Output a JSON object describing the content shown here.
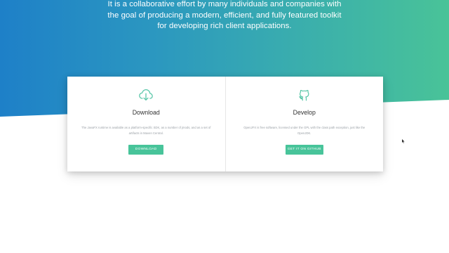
{
  "hero": {
    "line1": "It is a collaborative effort by many individuals and companies with",
    "line2": "the goal of producing a modern, efficient, and fully featured toolkit",
    "line3": "for developing rich client applications."
  },
  "cards": [
    {
      "id": "download",
      "icon": "cloud-download-icon",
      "title": "Download",
      "description": "The JavaFX runtime is available as a platform-specific SDK, as a number of jmods, and as a set of artifacts in Maven Central.",
      "button_label": "DOWNLOAD"
    },
    {
      "id": "develop",
      "icon": "github-icon",
      "title": "Develop",
      "description": "OpenJFX is free software, licensed under the GPL with the class path exception, just like the OpenJDK.",
      "button_label": "GET IT ON GITHUB"
    }
  ],
  "colors": {
    "gradient_start": "#1e80c8",
    "gradient_end": "#49c398",
    "accent_button": "#48c49a",
    "icon": "#58c6a8"
  }
}
